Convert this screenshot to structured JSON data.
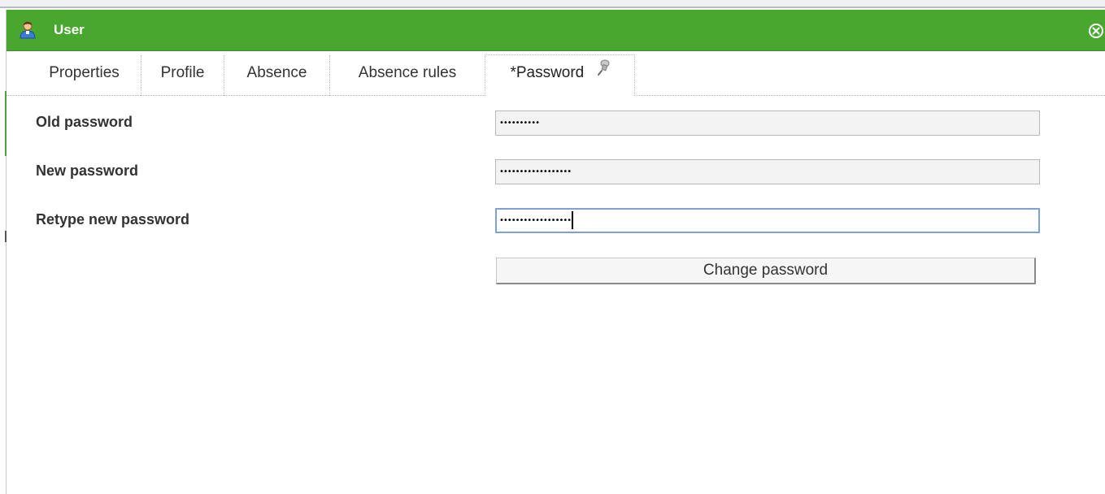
{
  "window": {
    "title": "User",
    "accent_color": "#47a72f",
    "icons": {
      "title": "user-icon",
      "close": "close-icon"
    }
  },
  "tabs": [
    {
      "label": "Properties",
      "active": false
    },
    {
      "label": "Profile",
      "active": false
    },
    {
      "label": "Absence",
      "active": false
    },
    {
      "label": "Absence rules",
      "active": false
    },
    {
      "label": "*Password",
      "active": true,
      "icon": "pin-icon"
    }
  ],
  "form": {
    "old_password": {
      "label": "Old password",
      "value": "••••••••••"
    },
    "new_password": {
      "label": "New password",
      "value": "••••••••••••••••••"
    },
    "retype_password": {
      "label": "Retype new password",
      "value": "••••••••••••••••••",
      "focused": true
    },
    "submit_label": "Change password"
  }
}
